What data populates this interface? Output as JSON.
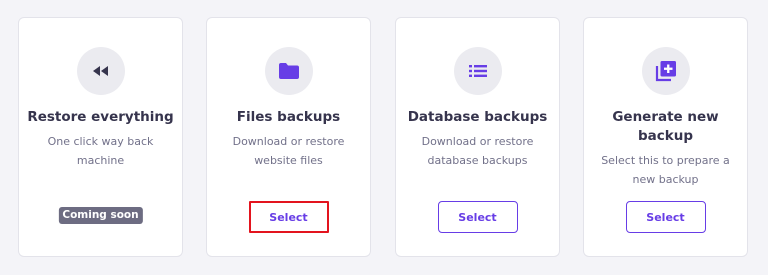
{
  "cards": [
    {
      "icon": "rewind-icon",
      "title": "Restore everything",
      "desc_lines": [
        "One click way back",
        "machine"
      ],
      "badge": "Coming soon"
    },
    {
      "icon": "folder-icon",
      "title": "Files backups",
      "desc_lines": [
        "Download or restore",
        "website files"
      ],
      "button": "Select",
      "highlighted": true
    },
    {
      "icon": "list-icon",
      "title": "Database backups",
      "desc_lines": [
        "Download or restore",
        "database backups"
      ],
      "button": "Select"
    },
    {
      "icon": "add-copy-icon",
      "title_lines": [
        "Generate new",
        "backup"
      ],
      "desc_lines": [
        "Select this to prepare a",
        "new backup"
      ],
      "button": "Select"
    }
  ],
  "colors": {
    "accent": "#673de6",
    "highlight_border": "#e3141e",
    "badge_bg": "#6d6c82",
    "page_bg": "#f4f4f8"
  }
}
